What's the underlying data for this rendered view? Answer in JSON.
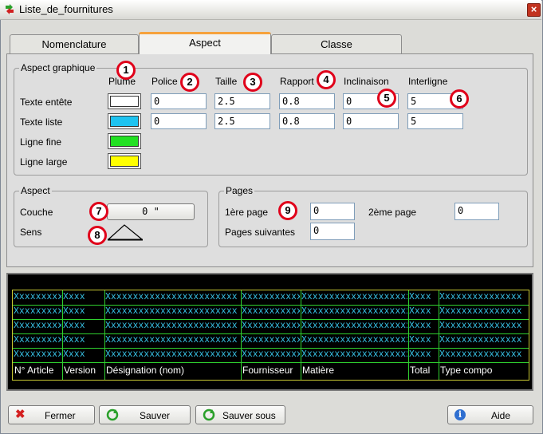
{
  "window": {
    "title": "Liste_de_fournitures",
    "close_glyph": "×",
    "icon": "green-arrows-icon"
  },
  "tabs": [
    {
      "label": "Nomenclature",
      "active": false
    },
    {
      "label": "Aspect",
      "active": true
    },
    {
      "label": "Classe",
      "active": false
    }
  ],
  "aspect_graphique": {
    "legend": "Aspect graphique",
    "columns": {
      "plume": "Plume",
      "police": "Police",
      "taille": "Taille",
      "rapport": "Rapport",
      "inclinaison": "Inclinaison",
      "interligne": "Interligne"
    },
    "rows": [
      {
        "label": "Texte entête",
        "color": "#ffffff",
        "police": "0",
        "taille": "2.5",
        "rapport": "0.8",
        "inclinaison": "0",
        "interligne": "5"
      },
      {
        "label": "Texte liste",
        "color": "#1ec3f0",
        "police": "0",
        "taille": "2.5",
        "rapport": "0.8",
        "inclinaison": "0",
        "interligne": "5"
      },
      {
        "label": "Ligne fine",
        "color": "#22e022"
      },
      {
        "label": "Ligne large",
        "color": "#ffff00"
      }
    ]
  },
  "aspect": {
    "legend": "Aspect",
    "couche_label": "Couche",
    "couche_value": "0 \"",
    "sens_label": "Sens"
  },
  "pages": {
    "legend": "Pages",
    "first_label": "1ère page",
    "first_value": "0",
    "second_label": "2ème page",
    "second_value": "0",
    "next_label": "Pages suivantes",
    "next_value": "0"
  },
  "badges": [
    "1",
    "2",
    "3",
    "4",
    "5",
    "6",
    "7",
    "8",
    "9"
  ],
  "preview": {
    "placeholder_rows": [
      [
        "Xxxxxxxxxxxx",
        "Xxxx",
        "Xxxxxxxxxxxxxxxxxxxxxxxx",
        "Xxxxxxxxxxxxxx",
        "Xxxxxxxxxxxxxxxxxxxxxx",
        "Xxxx",
        "Xxxxxxxxxxxxxxx"
      ],
      [
        "Xxxxxxxxxxxx",
        "Xxxx",
        "Xxxxxxxxxxxxxxxxxxxxxxxx",
        "Xxxxxxxxxxxxxx",
        "Xxxxxxxxxxxxxxxxxxxxxx",
        "Xxxx",
        "Xxxxxxxxxxxxxxx"
      ],
      [
        "Xxxxxxxxxxxx",
        "Xxxx",
        "Xxxxxxxxxxxxxxxxxxxxxxxx",
        "Xxxxxxxxxxxxxx",
        "Xxxxxxxxxxxxxxxxxxxxxx",
        "Xxxx",
        "Xxxxxxxxxxxxxxx"
      ],
      [
        "Xxxxxxxxxxxx",
        "Xxxx",
        "Xxxxxxxxxxxxxxxxxxxxxxxx",
        "Xxxxxxxxxxxxxx",
        "Xxxxxxxxxxxxxxxxxxxxxx",
        "Xxxx",
        "Xxxxxxxxxxxxxxx"
      ],
      [
        "Xxxxxxxxxxxx",
        "Xxxx",
        "Xxxxxxxxxxxxxxxxxxxxxxxx",
        "Xxxxxxxxxxxxxx",
        "Xxxxxxxxxxxxxxxxxxxxxx",
        "Xxxx",
        "Xxxxxxxxxxxxxxx"
      ]
    ],
    "headers": [
      "N° Article",
      "Version",
      "Désignation (nom)",
      "Fournisseur",
      "Matière",
      "Total",
      "Type compo"
    ]
  },
  "buttons": {
    "fermer": "Fermer",
    "sauver": "Sauver",
    "sauver_sous": "Sauver sous",
    "aide": "Aide"
  },
  "colors": {
    "accent_tab": "#f6a23c",
    "badge_red": "#e0001a"
  }
}
